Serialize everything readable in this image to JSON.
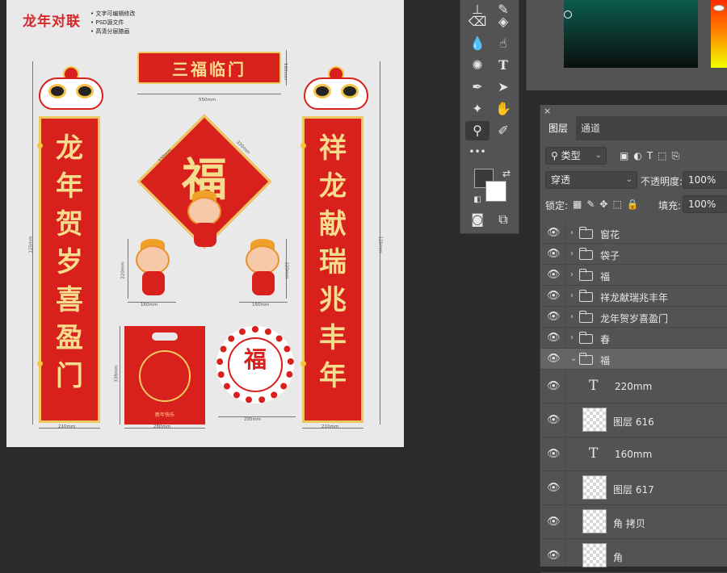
{
  "canvas": {
    "brand_title": "龙年对联",
    "bullets": [
      "文字可编辑修改",
      "PSD源文件",
      "高清分层随画"
    ],
    "banner_text": "三福临门",
    "left_scroll_chars": [
      "龙",
      "年",
      "贺",
      "岁",
      "喜",
      "盈",
      "门"
    ],
    "right_scroll_chars": [
      "祥",
      "龙",
      "献",
      "瑞",
      "兆",
      "丰",
      "年"
    ],
    "diamond_char": "福",
    "window_char": "福",
    "bag_footer": "新年快乐",
    "dims": {
      "banner_w": "550mm",
      "banner_h": "160mm",
      "scroll_h_left": "125mm",
      "scroll_h_right": "125mm",
      "scroll_w_left": "210mm",
      "scroll_w_right": "210mm",
      "diamond_a": "330mm",
      "diamond_b": "330mm",
      "mascot_h_left": "220mm",
      "mascot_h_right": "220mm",
      "mascot_w_left": "160mm",
      "mascot_w_right": "160mm",
      "bag_h": "338mm",
      "bag_w": "280mm",
      "window_w": "295mm"
    }
  },
  "toolbar": {
    "tools": [
      "stamp-icon",
      "eraser-icon",
      "fill-icon",
      "blur-icon",
      "smudge-icon",
      "sponge-icon",
      "type-icon",
      "pen-icon",
      "select-arrow-icon",
      "shape-icon",
      "hand-icon",
      "zoom-icon",
      "edit-icon"
    ],
    "more": "•••",
    "foreground_color": "#3b3b3b",
    "background_color": "#ffffff"
  },
  "color_picker": {
    "field_top": "#0d5b4d",
    "field_bottom": "#0a0f0e"
  },
  "layers_panel": {
    "close": "×",
    "tabs": [
      "图层",
      "通道"
    ],
    "filter": {
      "label": "类型",
      "icon": "search-icon"
    },
    "blend_mode": "穿透",
    "opacity_label": "不透明度:",
    "opacity_value": "100%",
    "lock_label": "锁定:",
    "fill_label": "填充:",
    "fill_value": "100%",
    "layers": [
      {
        "name": "窗花",
        "type": "group",
        "expanded": false
      },
      {
        "name": "袋子",
        "type": "group",
        "expanded": false
      },
      {
        "name": "福",
        "type": "group",
        "expanded": false
      },
      {
        "name": "祥龙献瑞兆丰年",
        "type": "group",
        "expanded": false
      },
      {
        "name": "龙年贺岁喜盈门",
        "type": "group",
        "expanded": false
      },
      {
        "name": "春",
        "type": "group",
        "expanded": false
      },
      {
        "name": "福",
        "type": "group",
        "expanded": true
      },
      {
        "name": "220mm",
        "type": "text"
      },
      {
        "name": "图层 616",
        "type": "pixel"
      },
      {
        "name": "160mm",
        "type": "text"
      },
      {
        "name": "图层 617",
        "type": "pixel"
      },
      {
        "name": "角 拷贝",
        "type": "pixel"
      },
      {
        "name": "角",
        "type": "pixel"
      }
    ]
  }
}
